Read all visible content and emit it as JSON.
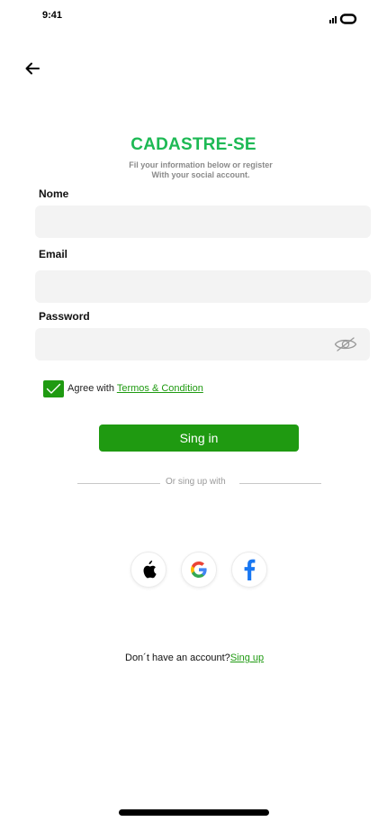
{
  "status_bar": {
    "time": "9:41"
  },
  "header": {
    "back_icon": "arrow-left-icon"
  },
  "title": "CADASTRE-SE",
  "subtitle": {
    "line1": "Fil your information below or register",
    "line2": "With your social account."
  },
  "form": {
    "name_label": "Nome",
    "name_value": "",
    "email_label": "Email",
    "email_value": "",
    "password_label": "Password",
    "password_value": "",
    "password_icon": "eye-off-icon"
  },
  "agree": {
    "checked": true,
    "text": "Agree with ",
    "link": "Termos & Condition"
  },
  "signin_label": "Sing in",
  "divider_text": "Or sing up with",
  "social": [
    "apple-icon",
    "google-icon",
    "facebook-icon"
  ],
  "footer": {
    "question": "Don´t have an account?",
    "link": "Sing up"
  },
  "colors": {
    "brand_green": "#1f9a11",
    "title_green": "#1db954",
    "field_bg": "#f3f3f3"
  }
}
